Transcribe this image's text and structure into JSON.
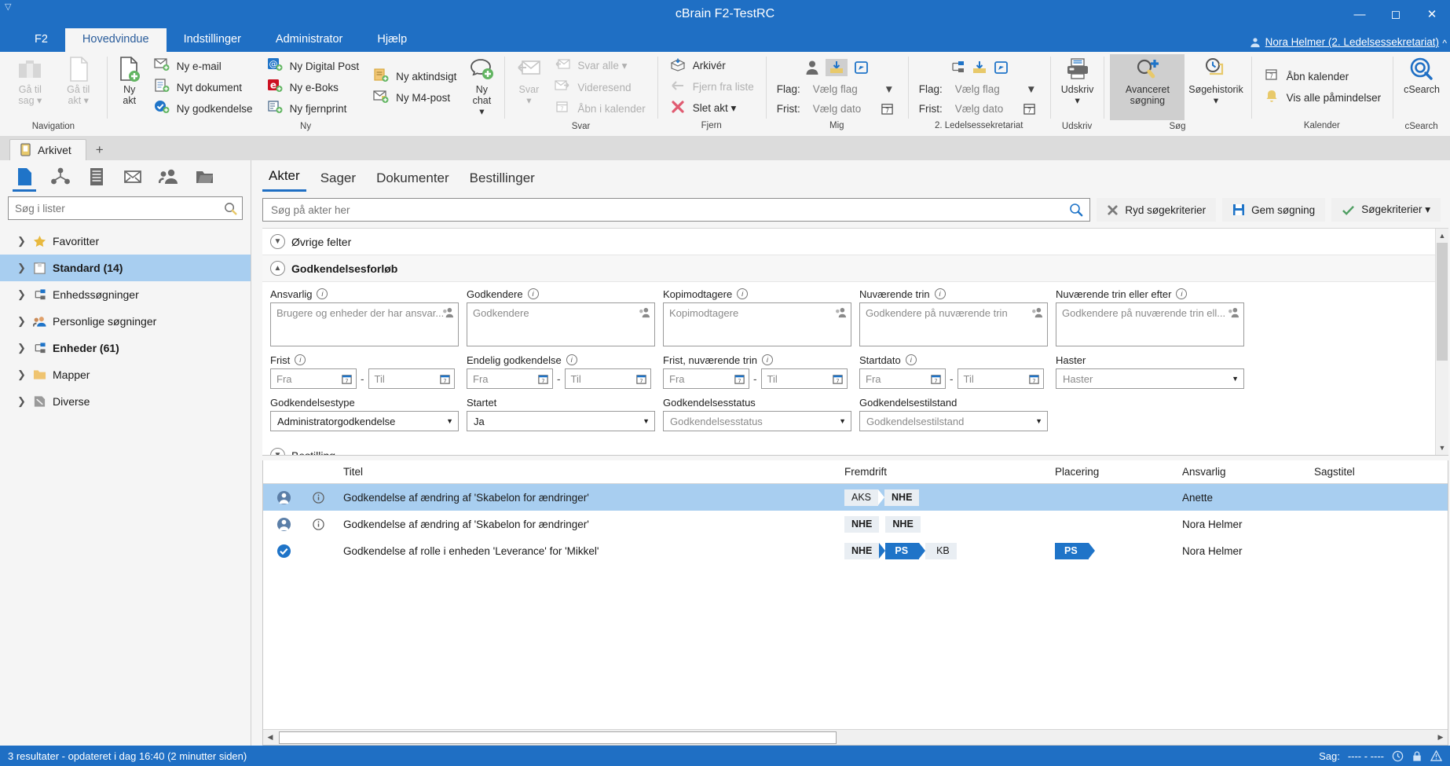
{
  "window": {
    "title": "cBrain F2-TestRC",
    "minimize": "─",
    "maximize": "☐",
    "close": "✕",
    "qat_icon": "customize-quick-access-icon",
    "collapse_ribbon": "⌃"
  },
  "menu": {
    "items": [
      {
        "label": "F2",
        "active": false
      },
      {
        "label": "Hovedvindue",
        "active": true
      },
      {
        "label": "Indstillinger",
        "active": false
      },
      {
        "label": "Administrator",
        "active": false
      },
      {
        "label": "Hjælp",
        "active": false
      }
    ],
    "user": "Nora Helmer (2. Ledelsessekretariat)"
  },
  "ribbon": {
    "groups": [
      {
        "label": "Navigation",
        "big": [
          {
            "label": "Gå til sag ▾",
            "disabled": true,
            "icon": "case-icon"
          },
          {
            "label": "Gå til akt ▾",
            "disabled": true,
            "icon": "record-icon"
          }
        ]
      },
      {
        "label": "Ny",
        "big": [
          {
            "label": "Ny akt",
            "disabled": false,
            "icon": "new-record-icon"
          }
        ],
        "small": [
          {
            "label": "Ny e-mail",
            "icon": "mail-icon"
          },
          {
            "label": "Nyt dokument",
            "icon": "document-icon"
          },
          {
            "label": "Ny godkendelse",
            "icon": "approval-icon"
          },
          {
            "label": "Ny Digital Post",
            "icon": "digital-post-icon"
          },
          {
            "label": "Ny e-Boks",
            "icon": "eboks-icon"
          },
          {
            "label": "Ny fjernprint",
            "icon": "remote-print-icon"
          },
          {
            "label": "Ny aktindsigt",
            "icon": "record-access-icon"
          },
          {
            "label": "Ny M4-post",
            "icon": "m4-post-icon"
          }
        ],
        "big2": [
          {
            "label": "Ny chat ▾",
            "disabled": false,
            "icon": "new-chat-icon"
          }
        ]
      },
      {
        "label": "Svar",
        "big": [
          {
            "label": "Svar ▾",
            "disabled": true,
            "icon": "reply-icon"
          }
        ],
        "small": [
          {
            "label": "Svar alle ▾",
            "disabled": true,
            "icon": "reply-all-icon"
          },
          {
            "label": "Videresend",
            "disabled": true,
            "icon": "forward-icon"
          },
          {
            "label": "Åbn i kalender",
            "disabled": true,
            "icon": "calendar-icon"
          }
        ]
      },
      {
        "label": "Fjern",
        "small": [
          {
            "label": "Arkivér",
            "disabled": false,
            "icon": "archive-icon"
          },
          {
            "label": "Fjern fra liste",
            "disabled": true,
            "icon": "remove-from-list-icon"
          },
          {
            "label": "Slet akt ▾",
            "disabled": false,
            "icon": "delete-icon"
          }
        ]
      },
      {
        "label": "Mig",
        "flag_label": "Flag:",
        "flag_value": "Vælg flag",
        "frist_label": "Frist:",
        "frist_value": "Vælg dato"
      },
      {
        "label": "2. Ledelsessekretariat",
        "flag_label": "Flag:",
        "flag_value": "Vælg flag",
        "frist_label": "Frist:",
        "frist_value": "Vælg dato"
      },
      {
        "label": "Udskriv",
        "big": [
          {
            "label": "Udskriv ▾",
            "disabled": false,
            "icon": "printer-icon"
          }
        ]
      },
      {
        "label": "Søg",
        "big": [
          {
            "label": "Avanceret søgning",
            "selected": true,
            "icon": "advanced-search-icon"
          },
          {
            "label": "Søgehistorik ▾",
            "selected": false,
            "icon": "search-history-icon"
          }
        ]
      },
      {
        "label": "Kalender",
        "small": [
          {
            "label": "Åbn kalender",
            "icon": "calendar-icon"
          },
          {
            "label": "Vis alle påmindelser",
            "icon": "bell-icon"
          }
        ]
      },
      {
        "label": "cSearch",
        "big": [
          {
            "label": "cSearch",
            "icon": "csearch-icon"
          }
        ]
      }
    ]
  },
  "doctabs": {
    "tabs": [
      {
        "label": "Arkivet",
        "icon": "archive-tab-icon",
        "active": true
      }
    ],
    "add_label": "+"
  },
  "sidebar": {
    "icon_tabs": [
      {
        "name": "records-icon",
        "active": true
      },
      {
        "name": "cases-icon",
        "active": false
      },
      {
        "name": "documents-icon",
        "active": false
      },
      {
        "name": "mail-merge-icon",
        "active": false
      },
      {
        "name": "contacts-icon",
        "active": false
      },
      {
        "name": "folders-icon",
        "active": false
      }
    ],
    "search_placeholder": "Søg i lister",
    "search_value": "",
    "items": [
      {
        "label": "Favoritter",
        "icon": "star-icon",
        "selected": false,
        "bold": false
      },
      {
        "label": "Standard (14)",
        "icon": "standard-icon",
        "selected": true,
        "bold": true
      },
      {
        "label": "Enhedssøgninger",
        "icon": "unit-search-icon",
        "selected": false,
        "bold": false
      },
      {
        "label": "Personlige søgninger",
        "icon": "personal-search-icon",
        "selected": false,
        "bold": false
      },
      {
        "label": "Enheder (61)",
        "icon": "unit-search-icon",
        "selected": false,
        "bold": true
      },
      {
        "label": "Mapper",
        "icon": "folder-icon",
        "selected": false,
        "bold": false
      },
      {
        "label": "Diverse",
        "icon": "misc-icon",
        "selected": false,
        "bold": false
      }
    ]
  },
  "main": {
    "tabs": [
      {
        "label": "Akter",
        "active": true
      },
      {
        "label": "Sager",
        "active": false
      },
      {
        "label": "Dokumenter",
        "active": false
      },
      {
        "label": "Bestillinger",
        "active": false
      }
    ],
    "search_placeholder": "Søg på akter her",
    "search_value": "",
    "buttons": [
      {
        "label": "Ryd søgekriterier",
        "icon": "clear-icon"
      },
      {
        "label": "Gem søgning",
        "icon": "save-icon"
      },
      {
        "label": "Søgekriterier ▾",
        "icon": "check-icon"
      }
    ]
  },
  "filters": {
    "sections": [
      {
        "title": "Øvrige felter",
        "expanded": false,
        "bold": false
      },
      {
        "title": "Godkendelsesforløb",
        "expanded": true,
        "bold": true
      },
      {
        "title": "Bestilling",
        "expanded": false,
        "bold": false
      }
    ],
    "row1": [
      {
        "label": "Ansvarlig",
        "info": true,
        "placeholder": "Brugere og enheder der har ansvar...",
        "value": ""
      },
      {
        "label": "Godkendere",
        "info": true,
        "placeholder": "Godkendere",
        "value": ""
      },
      {
        "label": "Kopimodtagere",
        "info": true,
        "placeholder": "Kopimodtagere",
        "value": ""
      },
      {
        "label": "Nuværende trin",
        "info": true,
        "placeholder": "Godkendere på nuværende trin",
        "value": ""
      },
      {
        "label": "Nuværende trin eller efter",
        "info": true,
        "placeholder": "Godkendere på nuværende trin ell...",
        "value": ""
      }
    ],
    "row2": [
      {
        "label": "Frist",
        "info": true,
        "type": "daterange",
        "from": "Fra",
        "to": "Til"
      },
      {
        "label": "Endelig godkendelse",
        "info": true,
        "type": "daterange",
        "from": "Fra",
        "to": "Til"
      },
      {
        "label": "Frist, nuværende trin",
        "info": true,
        "type": "daterange",
        "from": "Fra",
        "to": "Til"
      },
      {
        "label": "Startdato",
        "info": true,
        "type": "daterange",
        "from": "Fra",
        "to": "Til"
      },
      {
        "label": "Haster",
        "info": false,
        "type": "select",
        "value": "Haster",
        "empty": true
      }
    ],
    "row3": [
      {
        "label": "Godkendelsestype",
        "type": "select",
        "value": "Administratorgodkendelse",
        "empty": false
      },
      {
        "label": "Startet",
        "type": "select",
        "value": "Ja",
        "empty": false
      },
      {
        "label": "Godkendelsesstatus",
        "type": "select",
        "value": "Godkendelsesstatus",
        "empty": true
      },
      {
        "label": "Godkendelsestilstand",
        "type": "select",
        "value": "Godkendelsestilstand",
        "empty": true
      }
    ]
  },
  "results": {
    "columns": [
      {
        "label": "",
        "key": "icon1"
      },
      {
        "label": "",
        "key": "icon2"
      },
      {
        "label": "Titel",
        "key": "title"
      },
      {
        "label": "Fremdrift",
        "key": "progress"
      },
      {
        "label": "Placering",
        "key": "placement"
      },
      {
        "label": "Ansvarlig",
        "key": "responsible"
      },
      {
        "label": "Sagstitel",
        "key": "casetitle"
      }
    ],
    "rows": [
      {
        "selected": true,
        "icon1": "approval-user-icon",
        "icon2": "info-icon",
        "title": "Godkendelse af ændring af 'Skabelon for ændringer'",
        "progress": [
          {
            "text": "AKS",
            "style": "plain"
          },
          {
            "text": "NHE",
            "style": "plain-bold"
          }
        ],
        "placement": [],
        "responsible": "Anette",
        "casetitle": ""
      },
      {
        "selected": false,
        "icon1": "approval-user-icon",
        "icon2": "info-icon",
        "title": "Godkendelse af ændring af 'Skabelon for ændringer'",
        "progress": [
          {
            "text": "NHE",
            "style": "plain-bold"
          },
          {
            "text": "NHE",
            "style": "plain-bold"
          }
        ],
        "placement": [],
        "responsible": "Nora Helmer",
        "casetitle": ""
      },
      {
        "selected": false,
        "icon1": "approval-done-icon",
        "icon2": "",
        "title": "Godkendelse af rolle i enheden 'Leverance' for 'Mikkel'",
        "progress": [
          {
            "text": "NHE",
            "style": "plain-bold"
          },
          {
            "text": "PS",
            "style": "blue"
          },
          {
            "text": "KB",
            "style": "grey"
          }
        ],
        "placement": [
          {
            "text": "PS",
            "style": "blue"
          }
        ],
        "responsible": "Nora Helmer",
        "casetitle": ""
      }
    ]
  },
  "statusbar": {
    "left": "3 resultater - opdateret i dag 16:40 (2 minutter siden)",
    "case_label": "Sag:",
    "case_value": "---- - ----",
    "icons": [
      "history-icon",
      "lock-icon",
      "warning-icon"
    ]
  },
  "colors": {
    "accent": "#1f6fc4",
    "selection": "#a8cef0",
    "chip_blue": "#1f74c8",
    "chip_grey": "#e9eef3"
  }
}
